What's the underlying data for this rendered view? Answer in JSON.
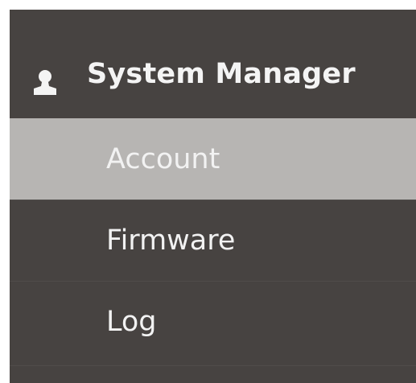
{
  "menu": {
    "header": {
      "icon": "user-icon",
      "title": "System Manager"
    },
    "items": [
      {
        "label": "Account",
        "active": true
      },
      {
        "label": "Firmware",
        "active": false
      },
      {
        "label": "Log",
        "active": false
      }
    ]
  },
  "colors": {
    "background": "#474341",
    "active_item": "#b7b5b3",
    "text": "#f2f2f2"
  }
}
